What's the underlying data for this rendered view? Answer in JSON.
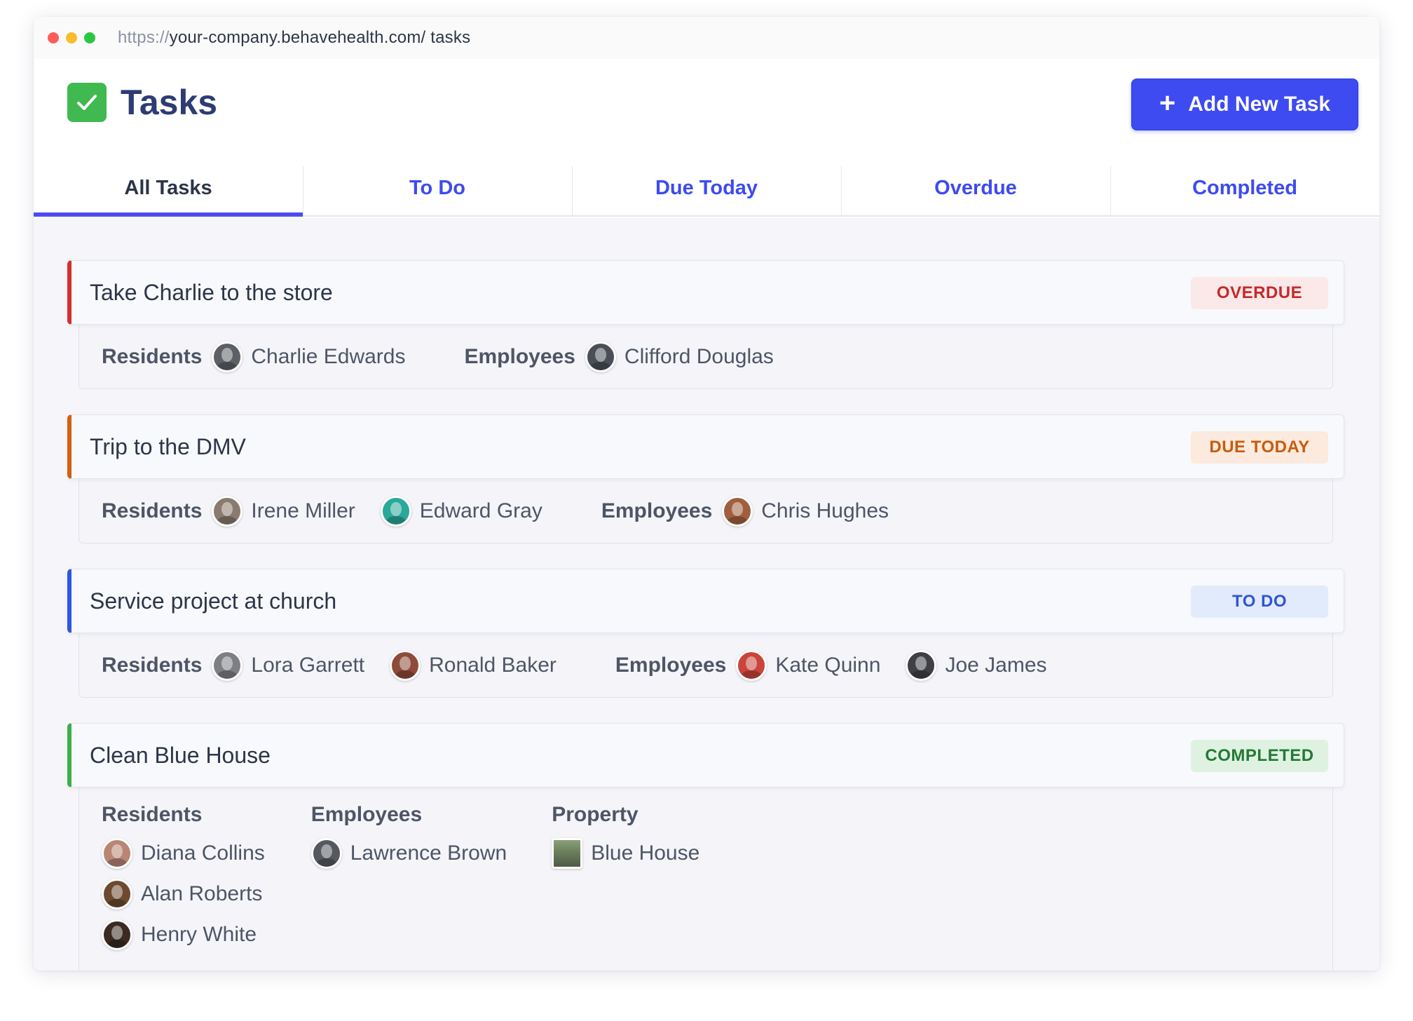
{
  "browser": {
    "url_protocol": "https://",
    "url_rest": "your-company.behavehealth.com/ tasks"
  },
  "header": {
    "title": "Tasks",
    "app_icon": "check-square-icon",
    "add_button_label": "Add New Task",
    "accent_color": "#3d4bf0"
  },
  "tabs": [
    {
      "label": "All Tasks",
      "active": true
    },
    {
      "label": "To Do",
      "active": false
    },
    {
      "label": "Due Today",
      "active": false
    },
    {
      "label": "Overdue",
      "active": false
    },
    {
      "label": "Completed",
      "active": false
    }
  ],
  "labels": {
    "residents": "Residents",
    "employees": "Employees",
    "property": "Property"
  },
  "tasks": [
    {
      "title": "Take Charlie to the store",
      "status": "OVERDUE",
      "status_color": "#c62828",
      "residents": [
        "Charlie Edwards"
      ],
      "employees": [
        "Clifford Douglas"
      ]
    },
    {
      "title": "Trip to the DMV",
      "status": "DUE TODAY",
      "status_color": "#c75b0e",
      "residents": [
        "Irene Miller",
        "Edward Gray"
      ],
      "employees": [
        "Chris Hughes"
      ]
    },
    {
      "title": "Service project at church",
      "status": "TO DO",
      "status_color": "#2f55d4",
      "residents": [
        "Lora Garrett",
        "Ronald Baker"
      ],
      "employees": [
        "Kate Quinn",
        "Joe James"
      ]
    },
    {
      "title": "Clean Blue House",
      "status": "COMPLETED",
      "status_color": "#237a35",
      "residents": [
        "Diana Collins",
        "Alan Roberts",
        "Henry White"
      ],
      "employees": [
        "Lawrence Brown"
      ],
      "property": [
        "Blue House"
      ]
    }
  ]
}
